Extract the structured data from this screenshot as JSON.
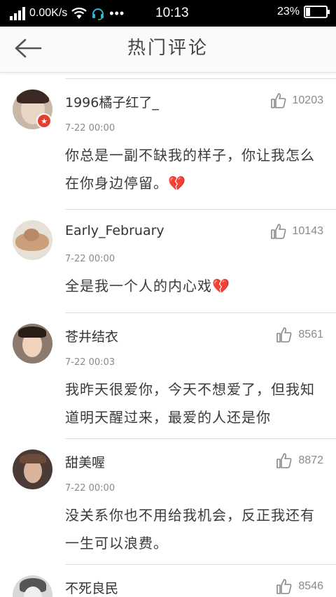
{
  "status_bar": {
    "speed": "0.00K/s",
    "dots": "•••",
    "time": "10:13",
    "battery_text": "23%",
    "battery_level": 0.23
  },
  "header": {
    "title": "热门评论",
    "back_icon": "arrow-left-icon"
  },
  "comments": [
    {
      "username": "1996橘子红了_",
      "timestamp": "7-22 00:00",
      "likes": "10203",
      "content": "你总是一副不缺我的样子，你让我怎么在你身边停留。",
      "emoji": "💔",
      "has_badge": true
    },
    {
      "username": "Early_February",
      "timestamp": "7-22 00:00",
      "likes": "10143",
      "content": "全是我一个人的内心戏",
      "emoji": "💔"
    },
    {
      "username": "苍井结衣",
      "timestamp": "7-22 00:03",
      "likes": "8561",
      "content": "我昨天很爱你，今天不想爱了，但我知道明天醒过来，最爱的人还是你",
      "emoji": ""
    },
    {
      "username": "甜美喔",
      "timestamp": "7-22 00:00",
      "likes": "8872",
      "content": "没关系你也不用给我机会，反正我还有一生可以浪费。",
      "emoji": ""
    },
    {
      "username": "不死良民",
      "timestamp": "",
      "likes": "8546",
      "content": "",
      "emoji": ""
    }
  ],
  "colors": {
    "status_bar_bg": "#000000",
    "header_bg": "#fafafa",
    "badge": "#e63b2e",
    "broken_heart": "#d9463a"
  }
}
